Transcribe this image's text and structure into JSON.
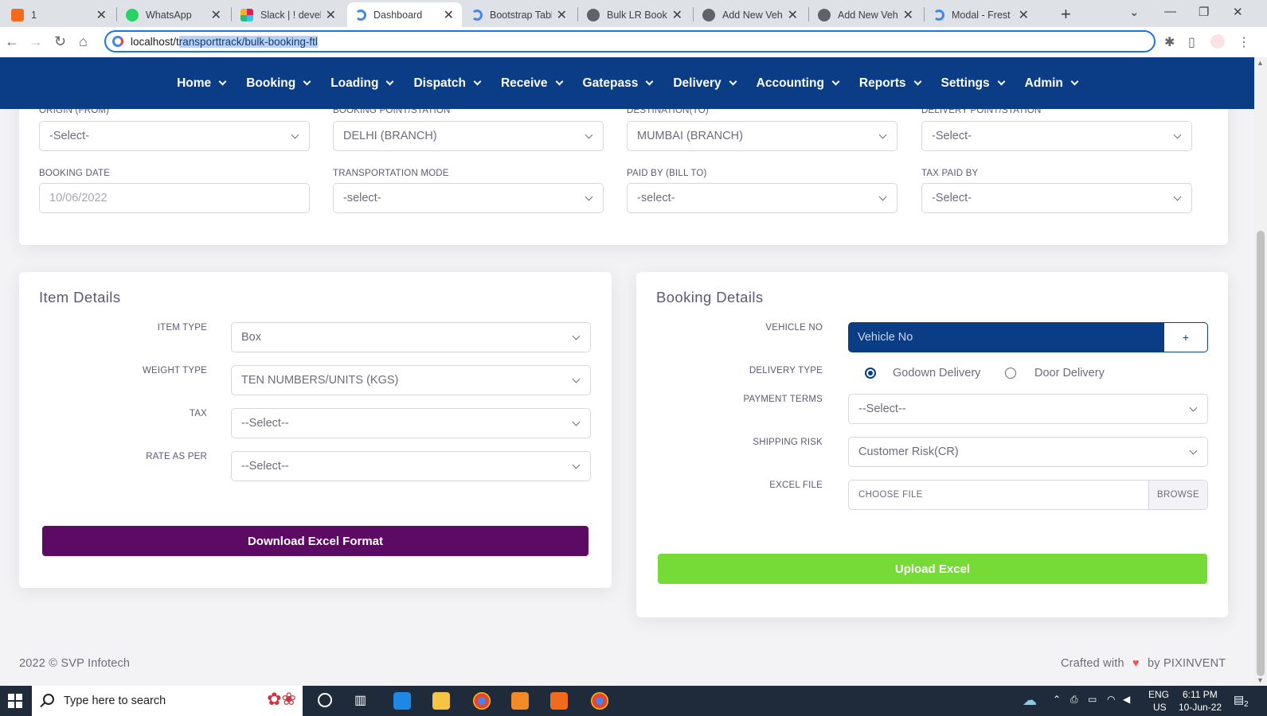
{
  "browser": {
    "tabs": [
      {
        "title": "1",
        "favicon_color": "#f26b1d"
      },
      {
        "title": "WhatsApp",
        "favicon_color": "#25d366"
      },
      {
        "title": "Slack | ! develop",
        "favicon_color": "#e01e5a"
      },
      {
        "title": "Dashboard",
        "favicon_color": "#4285f4",
        "active": true
      },
      {
        "title": "Bootstrap Table",
        "favicon_color": "#4285f4"
      },
      {
        "title": "Bulk LR Booking",
        "favicon_color": "#5f6368"
      },
      {
        "title": "Add New Vehicl",
        "favicon_color": "#5f6368"
      },
      {
        "title": "Add New Vehicl",
        "favicon_color": "#5f6368"
      },
      {
        "title": "Modal - Frest -",
        "favicon_color": "#4285f4"
      }
    ],
    "url_prefix": "localhost/t",
    "url_selected": "ransporttrack/bulk-booking-ftl"
  },
  "nav": {
    "items": [
      "Home",
      "Booking",
      "Loading",
      "Dispatch",
      "Receive",
      "Gatepass",
      "Delivery",
      "Accounting",
      "Reports",
      "Settings",
      "Admin"
    ],
    "bg_color": "#0a3d86"
  },
  "top_form": {
    "origin_label": "ORIGIN (FROM)",
    "origin_value": "-Select-",
    "booking_point_label": "BOOKING POINT/STATION",
    "booking_point_value": "DELHI (BRANCH)",
    "destination_label": "DESTINATION(TO)",
    "destination_value": "MUMBAI (BRANCH)",
    "delivery_point_label": "DELIVERY POINT/STATION",
    "delivery_point_value": "-Select-",
    "booking_date_label": "BOOKING DATE",
    "booking_date_value": "10/06/2022",
    "transport_mode_label": "TRANSPORTATION MODE",
    "transport_mode_value": "-select-",
    "paid_by_label": "PAID BY (BILL TO)",
    "paid_by_value": "-select-",
    "tax_paid_label": "TAX PAID BY",
    "tax_paid_value": "-Select-"
  },
  "item_details": {
    "title": "Item Details",
    "item_type_label": "ITEM TYPE",
    "item_type_value": "Box",
    "weight_type_label": "WEIGHT TYPE",
    "weight_type_value": "TEN NUMBERS/UNITS (KGS)",
    "tax_label": "TAX",
    "tax_value": "--Select--",
    "rate_label": "RATE AS PER",
    "rate_value": "--Select--",
    "download_button": "Download Excel Format",
    "download_color": "#5c0a63"
  },
  "booking_details": {
    "title": "Booking Details",
    "vehicle_label": "VEHICLE NO",
    "vehicle_placeholder": "Vehicle No",
    "vehicle_add": "+",
    "delivery_type_label": "DELIVERY TYPE",
    "delivery_option_1": "Godown Delivery",
    "delivery_option_2": "Door Delivery",
    "payment_label": "PAYMENT TERMS",
    "payment_value": "--Select--",
    "shipping_label": "SHIPPING RISK",
    "shipping_value": "Customer Risk(CR)",
    "excel_label": "EXCEL FILE",
    "excel_placeholder": "CHOOSE FILE",
    "browse": "BROWSE",
    "upload_button": "Upload Excel",
    "upload_color": "#76db37"
  },
  "footer": {
    "copyright": "2022 © SVP Infotech",
    "crafted_prefix": "Crafted with",
    "crafted_suffix": "by PIXINVENT"
  },
  "taskbar": {
    "search_placeholder": "Type here to search",
    "lang_1": "ENG",
    "lang_2": "US",
    "time": "6:11 PM",
    "date": "10-Jun-22",
    "notif_count": "2"
  }
}
